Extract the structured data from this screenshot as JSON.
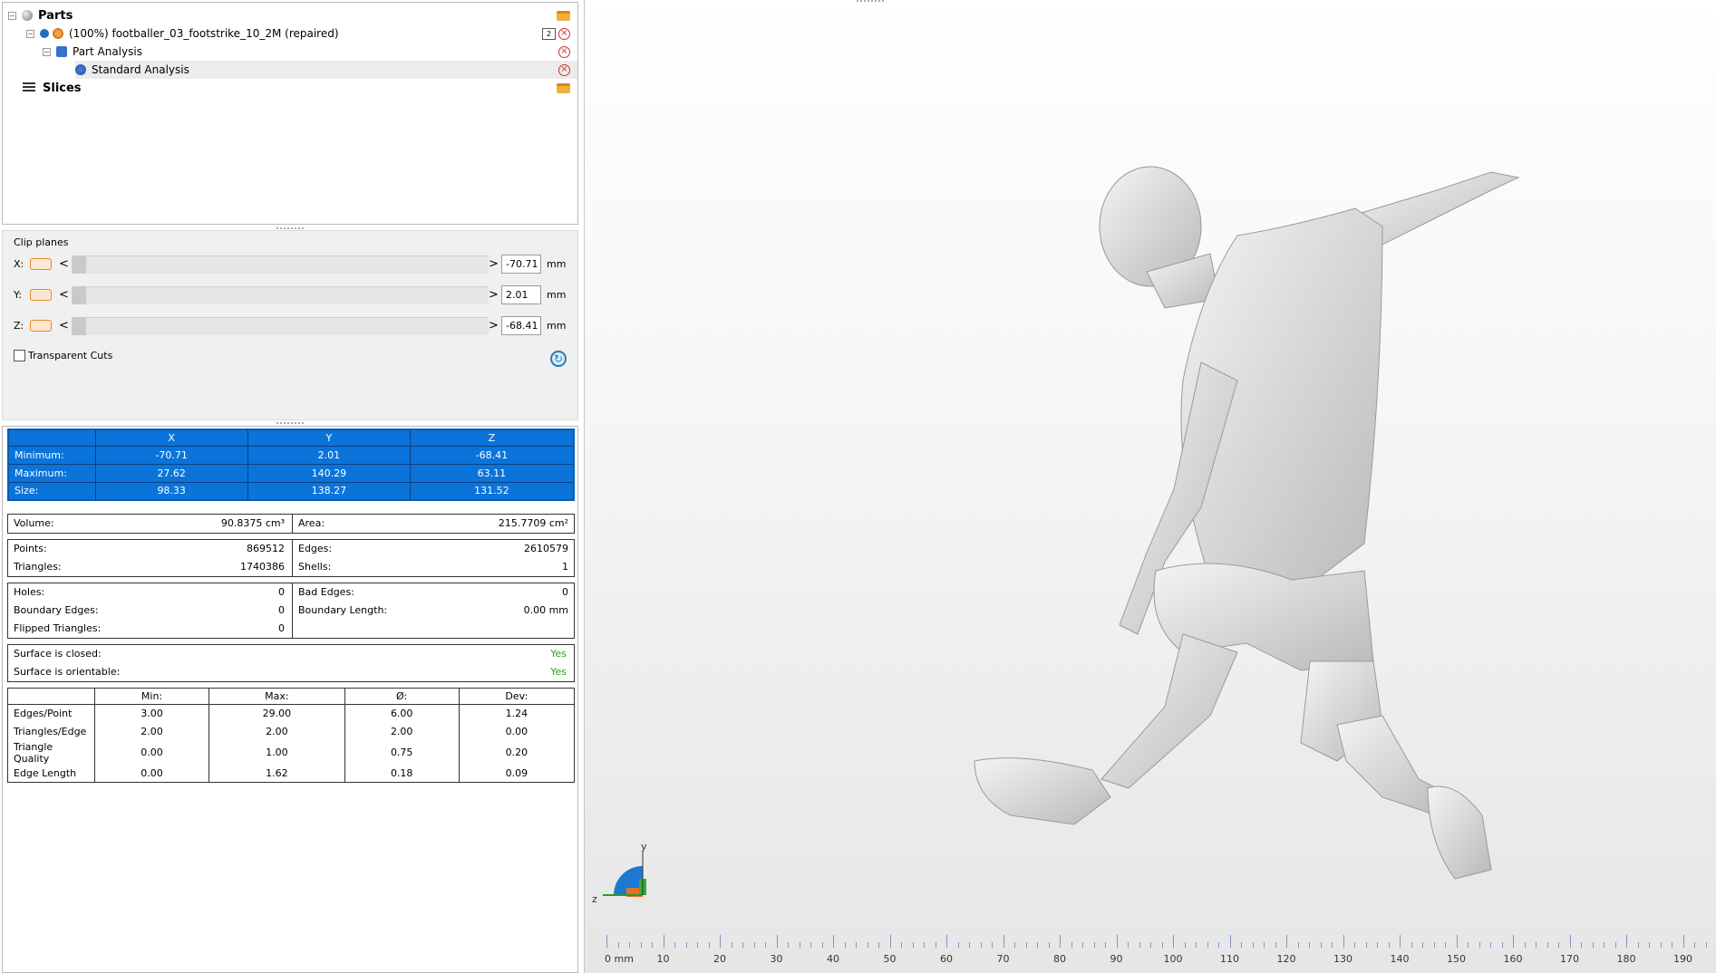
{
  "tree": {
    "parts_label": "Parts",
    "file_label": "(100%) footballer_03_footstrike_10_2M (repaired)",
    "file_badge": "2",
    "part_analysis_label": "Part Analysis",
    "standard_analysis_label": "Standard Analysis",
    "slices_label": "Slices"
  },
  "clip": {
    "title": "Clip planes",
    "rows": [
      {
        "axis": "X:",
        "value": "-70.71",
        "unit": "mm"
      },
      {
        "axis": "Y:",
        "value": "2.01",
        "unit": "mm"
      },
      {
        "axis": "Z:",
        "value": "-68.41",
        "unit": "mm"
      }
    ],
    "left_arrow": "<",
    "right_arrow": ">",
    "transparent_cuts_label": "Transparent Cuts",
    "transparent_cuts_checked": false
  },
  "bounds": {
    "headers": [
      "X",
      "Y",
      "Z"
    ],
    "rows": [
      {
        "label": "Minimum:",
        "values": [
          "-70.71",
          "2.01",
          "-68.41"
        ]
      },
      {
        "label": "Maximum:",
        "values": [
          "27.62",
          "140.29",
          "63.11"
        ]
      },
      {
        "label": "Size:",
        "values": [
          "98.33",
          "138.27",
          "131.52"
        ]
      }
    ],
    "highlight_color": "#0a74da"
  },
  "metrics": {
    "volume_label": "Volume:",
    "volume_value": "90.8375 cm³",
    "area_label": "Area:",
    "area_value": "215.7709 cm²",
    "points_label": "Points:",
    "points_value": "869512",
    "triangles_label": "Triangles:",
    "triangles_value": "1740386",
    "edges_label": "Edges:",
    "edges_value": "2610579",
    "shells_label": "Shells:",
    "shells_value": "1",
    "holes_label": "Holes:",
    "holes_value": "0",
    "boundary_edges_label": "Boundary Edges:",
    "boundary_edges_value": "0",
    "flipped_label": "Flipped Triangles:",
    "flipped_value": "0",
    "bad_edges_label": "Bad Edges:",
    "bad_edges_value": "0",
    "boundary_length_label": "Boundary Length:",
    "boundary_length_value": "0.00 mm",
    "closed_label": "Surface is closed:",
    "closed_value": "Yes",
    "orientable_label": "Surface is orientable:",
    "orientable_value": "Yes",
    "yes_color": "#2a9a2a"
  },
  "quality": {
    "headers": [
      "Min:",
      "Max:",
      "Ø:",
      "Dev:"
    ],
    "rows": [
      {
        "label": "Edges/Point",
        "values": [
          "3.00",
          "29.00",
          "6.00",
          "1.24"
        ]
      },
      {
        "label": "Triangles/Edge",
        "values": [
          "2.00",
          "2.00",
          "2.00",
          "0.00"
        ]
      },
      {
        "label": "Triangle Quality",
        "values": [
          "0.00",
          "1.00",
          "0.75",
          "0.20"
        ]
      },
      {
        "label": "Edge Length",
        "values": [
          "0.00",
          "1.62",
          "0.18",
          "0.09"
        ]
      }
    ]
  },
  "viewport": {
    "axis_y": "y",
    "axis_z": "z",
    "ruler_labels": [
      "0 mm",
      "10",
      "20",
      "30",
      "40",
      "50",
      "60",
      "70",
      "80",
      "90",
      "100",
      "110",
      "120",
      "130",
      "140",
      "150",
      "160",
      "170",
      "180",
      "190"
    ]
  }
}
